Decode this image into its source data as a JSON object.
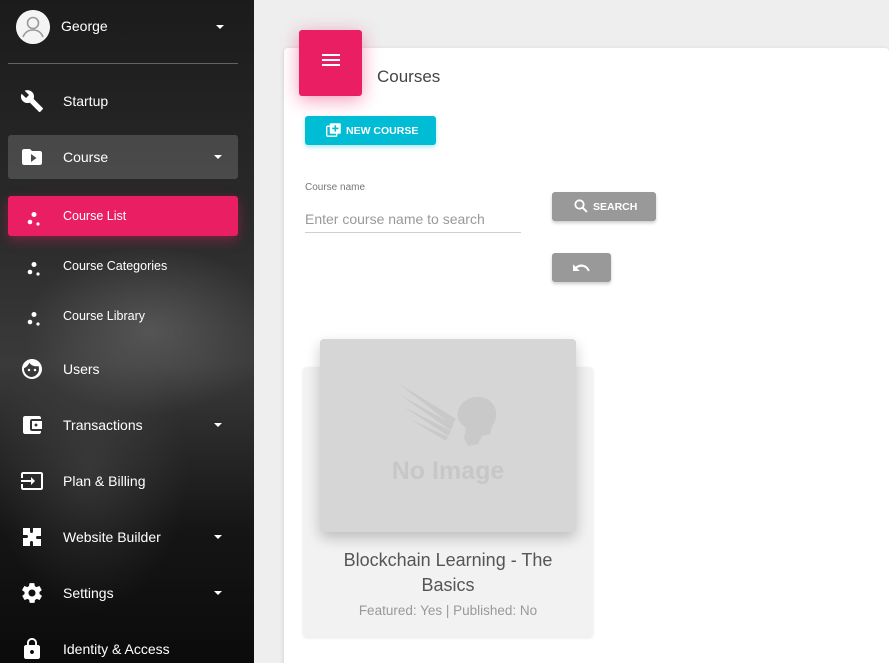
{
  "sidebar": {
    "user": {
      "name": "George"
    },
    "items": [
      {
        "label": "Startup"
      },
      {
        "label": "Course"
      },
      {
        "label": "Course List"
      },
      {
        "label": "Course Categories"
      },
      {
        "label": "Course Library"
      },
      {
        "label": "Users"
      },
      {
        "label": "Transactions"
      },
      {
        "label": "Plan & Billing"
      },
      {
        "label": "Website Builder"
      },
      {
        "label": "Settings"
      },
      {
        "label": "Identity & Access"
      }
    ]
  },
  "main": {
    "title": "Courses",
    "new_course_label": "NEW COURSE",
    "search": {
      "label": "Course name",
      "placeholder": "Enter course name to search",
      "value": "",
      "button_label": "SEARCH"
    },
    "courses": [
      {
        "thumbnail_text": "No Image",
        "title": "Blockchain Learning - The Basics",
        "meta": "Featured: Yes | Published: No"
      }
    ]
  },
  "colors": {
    "accent_pink": "#e91e63",
    "accent_cyan": "#00bcd4",
    "button_grey": "#999999"
  }
}
